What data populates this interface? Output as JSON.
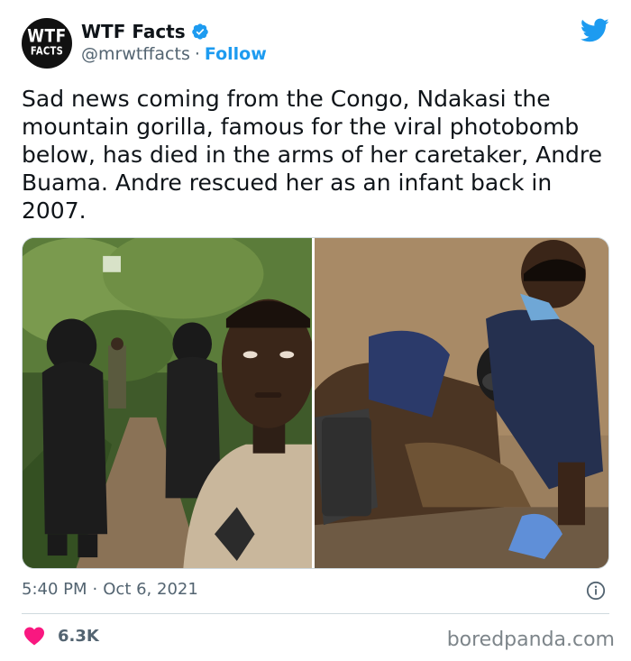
{
  "author": {
    "avatar_line1": "WTF",
    "avatar_line2": "FACTS",
    "display_name": "WTF Facts",
    "handle": "@mrwtffacts",
    "separator": "·",
    "follow_label": "Follow",
    "verified": true
  },
  "tweet": {
    "text": "Sad news coming from the Congo, Ndakasi the mountain gorilla, famous for the viral photobomb below, has died in the arms of her caretaker, Andre Buama. Andre rescued her as an infant back in 2007."
  },
  "meta": {
    "time": "5:40 PM",
    "dot": "·",
    "date": "Oct 6, 2021"
  },
  "engagement": {
    "likes": "6.3K"
  },
  "watermark": "boredpanda.com",
  "icons": {
    "brand": "twitter-bird-icon",
    "verified": "verified-badge-icon",
    "info": "info-icon",
    "like": "heart-icon"
  },
  "colors": {
    "accent": "#1d9bf0",
    "like": "#f91880",
    "secondary_text": "#536471"
  }
}
